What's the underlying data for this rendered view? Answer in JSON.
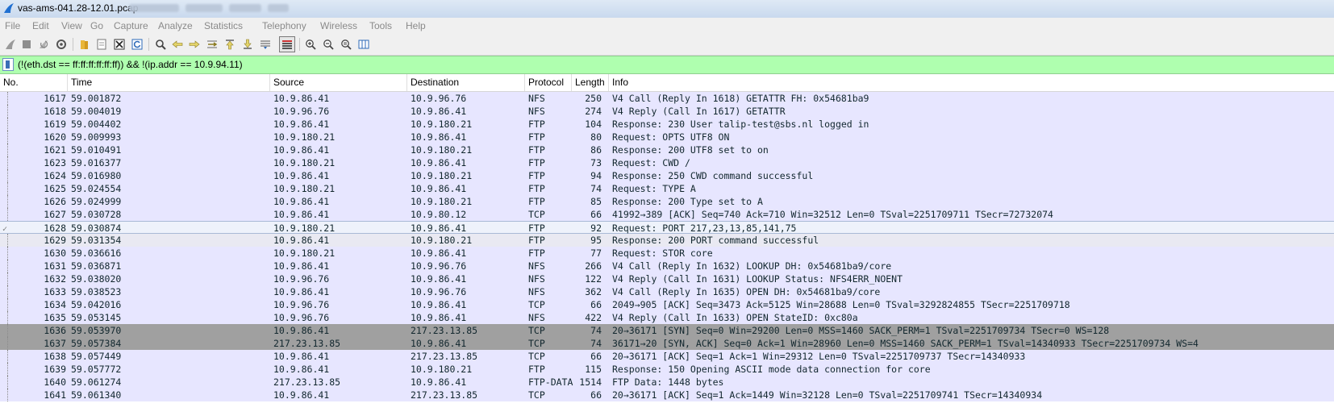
{
  "window": {
    "title": "vas-ams-041.28-12.01.pcap"
  },
  "menu": [
    "File",
    "Edit",
    "View",
    "Go",
    "Capture",
    "Analyze",
    "Statistics",
    "Telephony",
    "Wireless",
    "Tools",
    "Help"
  ],
  "toolbar": {
    "icons": [
      "shark-fin-start-icon",
      "stop-icon",
      "restart-icon",
      "capture-options-icon",
      "open-folder-icon",
      "file-set-icon",
      "close-file-icon",
      "reload-icon",
      "find-icon",
      "back-arrow-icon",
      "forward-arrow-icon",
      "go-to-packet-icon",
      "first-packet-icon",
      "last-packet-icon",
      "autoscroll-icon",
      "colorize-icon",
      "zoom-in-icon",
      "zoom-out-icon",
      "zoom-normal-icon",
      "resize-columns-icon"
    ]
  },
  "filter": {
    "text": "(!(eth.dst == ff:ff:ff:ff:ff:ff)) && !(ip.addr == 10.9.94.11)"
  },
  "columns": [
    "No.",
    "Time",
    "Source",
    "Destination",
    "Protocol",
    "Length",
    "Info"
  ],
  "packets": [
    {
      "no": "1617",
      "time": "59.001872",
      "src": "10.9.86.41",
      "dst": "10.9.96.76",
      "proto": "NFS",
      "len": "250",
      "info": "V4 Call (Reply In 1618) GETATTR FH: 0x54681ba9",
      "style": "nfs"
    },
    {
      "no": "1618",
      "time": "59.004019",
      "src": "10.9.96.76",
      "dst": "10.9.86.41",
      "proto": "NFS",
      "len": "274",
      "info": "V4 Reply (Call In 1617) GETATTR",
      "style": "nfs"
    },
    {
      "no": "1619",
      "time": "59.004402",
      "src": "10.9.86.41",
      "dst": "10.9.180.21",
      "proto": "FTP",
      "len": "104",
      "info": "Response: 230 User talip-test@sbs.nl logged in",
      "style": "ftp"
    },
    {
      "no": "1620",
      "time": "59.009993",
      "src": "10.9.180.21",
      "dst": "10.9.86.41",
      "proto": "FTP",
      "len": "80",
      "info": "Request: OPTS UTF8 ON",
      "style": "ftp"
    },
    {
      "no": "1621",
      "time": "59.010491",
      "src": "10.9.86.41",
      "dst": "10.9.180.21",
      "proto": "FTP",
      "len": "86",
      "info": "Response: 200 UTF8 set to on",
      "style": "ftp"
    },
    {
      "no": "1623",
      "time": "59.016377",
      "src": "10.9.180.21",
      "dst": "10.9.86.41",
      "proto": "FTP",
      "len": "73",
      "info": "Request: CWD /",
      "style": "ftp"
    },
    {
      "no": "1624",
      "time": "59.016980",
      "src": "10.9.86.41",
      "dst": "10.9.180.21",
      "proto": "FTP",
      "len": "94",
      "info": "Response: 250 CWD command successful",
      "style": "ftp"
    },
    {
      "no": "1625",
      "time": "59.024554",
      "src": "10.9.180.21",
      "dst": "10.9.86.41",
      "proto": "FTP",
      "len": "74",
      "info": "Request: TYPE A",
      "style": "ftp"
    },
    {
      "no": "1626",
      "time": "59.024999",
      "src": "10.9.86.41",
      "dst": "10.9.180.21",
      "proto": "FTP",
      "len": "85",
      "info": "Response: 200 Type set to A",
      "style": "ftp"
    },
    {
      "no": "1627",
      "time": "59.030728",
      "src": "10.9.86.41",
      "dst": "10.9.80.12",
      "proto": "TCP",
      "len": "66",
      "info": "41992→389 [ACK] Seq=740 Ack=710 Win=32512 Len=0 TSval=2251709711 TSecr=72732074",
      "style": "tcp"
    },
    {
      "no": "1628",
      "time": "59.030874",
      "src": "10.9.180.21",
      "dst": "10.9.86.41",
      "proto": "FTP",
      "len": "92",
      "info": "Request: PORT 217,23,13,85,141,75",
      "style": "sel-light"
    },
    {
      "no": "1629",
      "time": "59.031354",
      "src": "10.9.86.41",
      "dst": "10.9.180.21",
      "proto": "FTP",
      "len": "95",
      "info": "Response: 200 PORT command successful",
      "style": "light"
    },
    {
      "no": "1630",
      "time": "59.036616",
      "src": "10.9.180.21",
      "dst": "10.9.86.41",
      "proto": "FTP",
      "len": "77",
      "info": "Request: STOR core",
      "style": "ftp"
    },
    {
      "no": "1631",
      "time": "59.036871",
      "src": "10.9.86.41",
      "dst": "10.9.96.76",
      "proto": "NFS",
      "len": "266",
      "info": "V4 Call (Reply In 1632) LOOKUP DH: 0x54681ba9/core",
      "style": "nfs"
    },
    {
      "no": "1632",
      "time": "59.038020",
      "src": "10.9.96.76",
      "dst": "10.9.86.41",
      "proto": "NFS",
      "len": "122",
      "info": "V4 Reply (Call In 1631) LOOKUP Status: NFS4ERR_NOENT",
      "style": "nfs"
    },
    {
      "no": "1633",
      "time": "59.038523",
      "src": "10.9.86.41",
      "dst": "10.9.96.76",
      "proto": "NFS",
      "len": "362",
      "info": "V4 Call (Reply In 1635) OPEN DH: 0x54681ba9/core",
      "style": "nfs"
    },
    {
      "no": "1634",
      "time": "59.042016",
      "src": "10.9.96.76",
      "dst": "10.9.86.41",
      "proto": "TCP",
      "len": "66",
      "info": "2049→905 [ACK] Seq=3473 Ack=5125 Win=28688 Len=0 TSval=3292824855 TSecr=2251709718",
      "style": "tcp"
    },
    {
      "no": "1635",
      "time": "59.053145",
      "src": "10.9.96.76",
      "dst": "10.9.86.41",
      "proto": "NFS",
      "len": "422",
      "info": "V4 Reply (Call In 1633) OPEN StateID: 0xc80a",
      "style": "nfs"
    },
    {
      "no": "1636",
      "time": "59.053970",
      "src": "10.9.86.41",
      "dst": "217.23.13.85",
      "proto": "TCP",
      "len": "74",
      "info": "20→36171 [SYN] Seq=0 Win=29200 Len=0 MSS=1460 SACK_PERM=1 TSval=2251709734 TSecr=0 WS=128",
      "style": "syn"
    },
    {
      "no": "1637",
      "time": "59.057384",
      "src": "217.23.13.85",
      "dst": "10.9.86.41",
      "proto": "TCP",
      "len": "74",
      "info": "36171→20 [SYN, ACK] Seq=0 Ack=1 Win=28960 Len=0 MSS=1460 SACK_PERM=1 TSval=14340933 TSecr=2251709734 WS=4",
      "style": "syn"
    },
    {
      "no": "1638",
      "time": "59.057449",
      "src": "10.9.86.41",
      "dst": "217.23.13.85",
      "proto": "TCP",
      "len": "66",
      "info": "20→36171 [ACK] Seq=1 Ack=1 Win=29312 Len=0 TSval=2251709737 TSecr=14340933",
      "style": "tcp"
    },
    {
      "no": "1639",
      "time": "59.057772",
      "src": "10.9.86.41",
      "dst": "10.9.180.21",
      "proto": "FTP",
      "len": "115",
      "info": "Response: 150 Opening ASCII mode data connection for core",
      "style": "ftp"
    },
    {
      "no": "1640",
      "time": "59.061274",
      "src": "217.23.13.85",
      "dst": "10.9.86.41",
      "proto": "FTP-DATA",
      "len": "1514",
      "info": "FTP Data: 1448 bytes",
      "style": "ftp"
    },
    {
      "no": "1641",
      "time": "59.061340",
      "src": "10.9.86.41",
      "dst": "217.23.13.85",
      "proto": "TCP",
      "len": "66",
      "info": "20→36171 [ACK] Seq=1 Ack=1449 Win=32128 Len=0 TSval=2251709741 TSecr=14340934",
      "style": "tcp"
    }
  ]
}
